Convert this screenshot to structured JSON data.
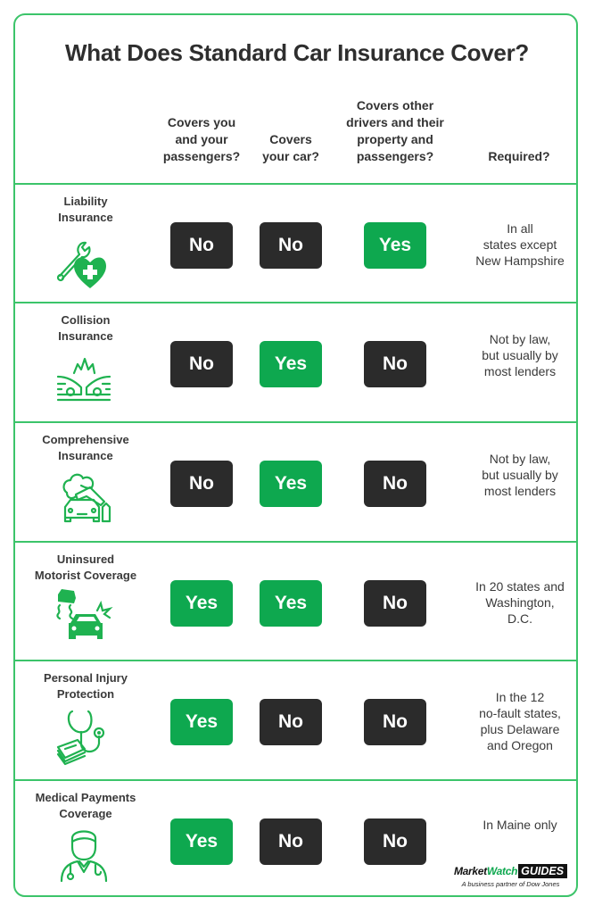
{
  "title": "What Does Standard Car Insurance Cover?",
  "columns": [
    "Covers you\nand your\npassengers?",
    "Covers\nyour car?",
    "Covers other\ndrivers and their\nproperty and\npassengers?",
    "Required?"
  ],
  "colors": {
    "yes": "#0ea84f",
    "no": "#2b2b2b",
    "border": "#3cc46a",
    "icon": "#1fb250"
  },
  "rows": [
    {
      "label": "Liability\nInsurance",
      "icon": "wrench-heart-icon",
      "covers_you": "No",
      "covers_car": "No",
      "covers_others": "Yes",
      "required": "In all\nstates except\nNew Hampshire"
    },
    {
      "label": "Collision\nInsurance",
      "icon": "car-collision-icon",
      "covers_you": "No",
      "covers_car": "Yes",
      "covers_others": "No",
      "required": "Not by law,\nbut usually by\nmost lenders"
    },
    {
      "label": "Comprehensive\nInsurance",
      "icon": "tree-on-car-icon",
      "covers_you": "No",
      "covers_car": "Yes",
      "covers_others": "No",
      "required": "Not by law,\nbut usually by\nmost lenders"
    },
    {
      "label": "Uninsured\nMotorist Coverage",
      "icon": "hit-and-run-car-icon",
      "covers_you": "Yes",
      "covers_car": "Yes",
      "covers_others": "No",
      "required": "In 20 states and\nWashington,\nD.C."
    },
    {
      "label": "Personal Injury\nProtection",
      "icon": "stethoscope-money-icon",
      "covers_you": "Yes",
      "covers_car": "No",
      "covers_others": "No",
      "required": "In the 12\nno-fault states,\nplus Delaware\nand Oregon"
    },
    {
      "label": "Medical Payments\nCoverage",
      "icon": "doctor-icon",
      "covers_you": "Yes",
      "covers_car": "No",
      "covers_others": "No",
      "required": "In Maine only"
    }
  ],
  "logo": {
    "market": "Market",
    "watch": "Watch",
    "guides": "GUIDES",
    "tagline": "A business partner of Dow Jones"
  }
}
